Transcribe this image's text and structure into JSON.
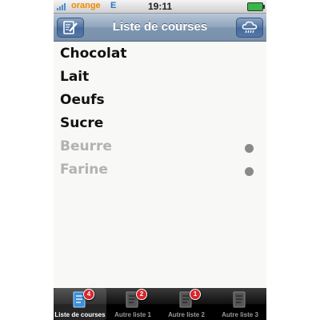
{
  "status_bar": {
    "carrier": "orange",
    "network": "E",
    "time": "19:11"
  },
  "navbar": {
    "title": "Liste de courses"
  },
  "items": [
    {
      "label": "Chocolat",
      "done": false
    },
    {
      "label": "Lait",
      "done": false
    },
    {
      "label": "Oeufs",
      "done": false
    },
    {
      "label": "Sucre",
      "done": false
    },
    {
      "label": "Beurre",
      "done": true
    },
    {
      "label": "Farine",
      "done": true
    }
  ],
  "tabs": [
    {
      "label": "Liste de courses",
      "badge": "4",
      "active": true
    },
    {
      "label": "Autre liste 1",
      "badge": "2",
      "active": false
    },
    {
      "label": "Autre liste 2",
      "badge": "1",
      "active": false
    },
    {
      "label": "Autre liste 3",
      "badge": "",
      "active": false
    }
  ],
  "colors": {
    "accent": "#7f96b1",
    "carrier": "#f08a00",
    "badge": "#d8262b",
    "done_text": "#b2b2b2"
  },
  "icons": [
    "edit-icon",
    "cloud-rain-icon",
    "document-icon"
  ]
}
